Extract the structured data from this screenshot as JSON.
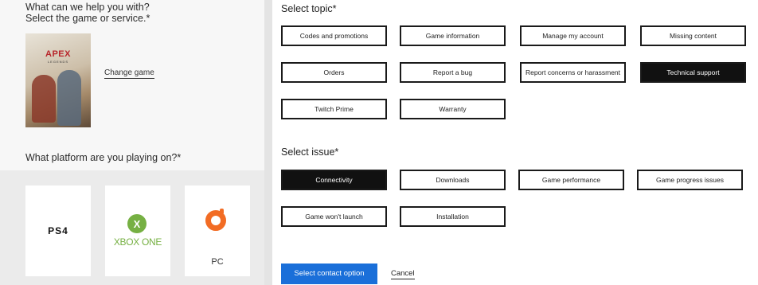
{
  "left": {
    "question1_line1": "What can we help you with?",
    "question1_line2": "Select the game or service.*",
    "game": {
      "cover_logo": "APEX",
      "cover_sub": "LEGENDS",
      "change_label": "Change game"
    },
    "question2": "What platform are you playing on?*",
    "platforms": {
      "ps4": "PS4",
      "xbox": "XBOX ONE",
      "pc": "PC"
    }
  },
  "topic": {
    "label": "Select topic*",
    "options": [
      "Codes and promotions",
      "Game information",
      "Manage my account",
      "Missing content",
      "Orders",
      "Report a bug",
      "Report concerns or harassment",
      "Technical support",
      "Twitch Prime",
      "Warranty"
    ],
    "selected": "Technical support"
  },
  "issue": {
    "label": "Select issue*",
    "options": [
      "Connectivity",
      "Downloads",
      "Game performance",
      "Game progress issues",
      "Game won't launch",
      "Installation"
    ],
    "selected": "Connectivity"
  },
  "actions": {
    "contact": "Select contact option",
    "cancel": "Cancel"
  },
  "colors": {
    "primary": "#1a6fd9",
    "selected_bg": "#111111",
    "xbox_green": "#76b043",
    "origin_orange": "#f26c24"
  }
}
